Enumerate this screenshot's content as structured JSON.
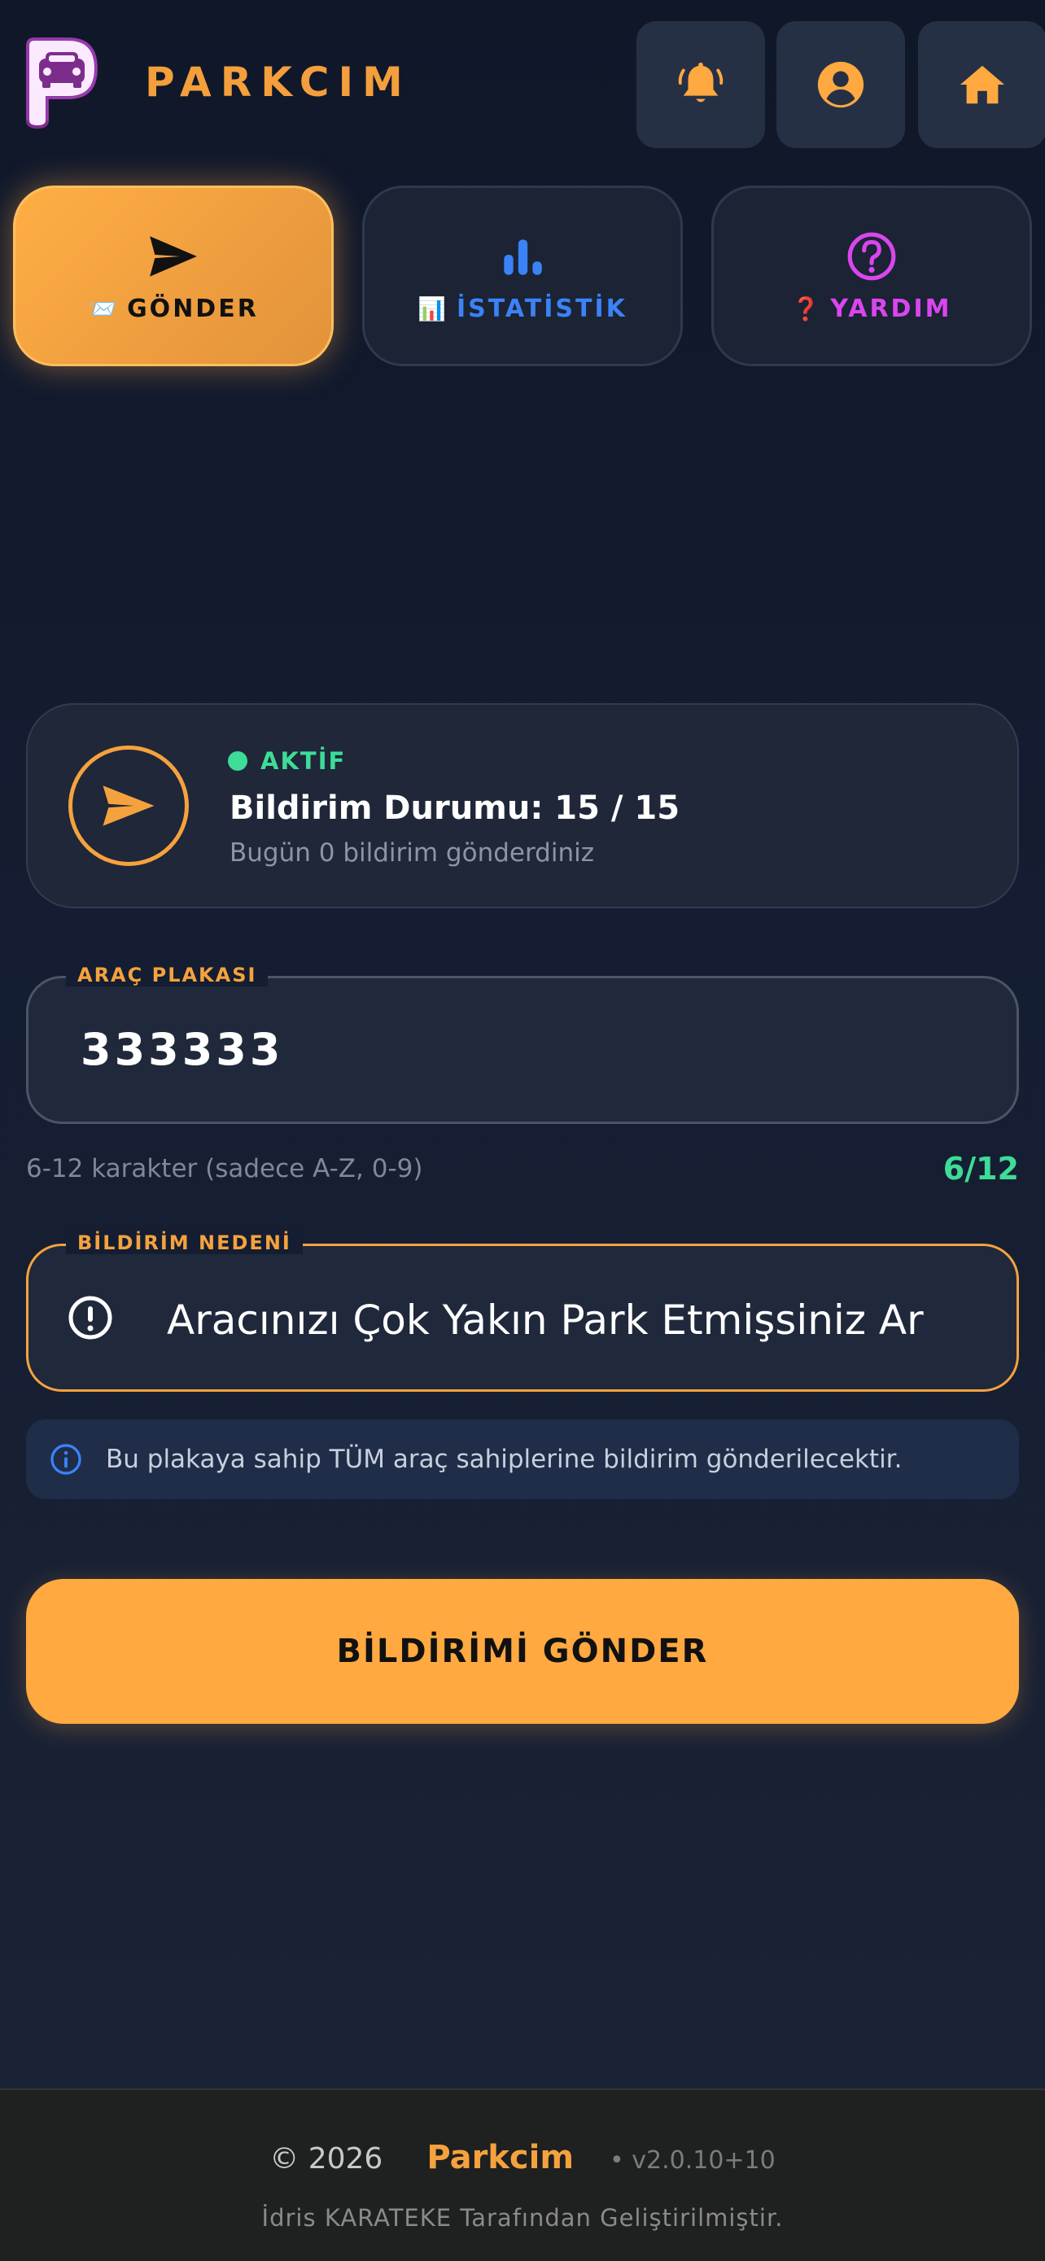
{
  "header": {
    "brand": "PARKCIM",
    "buttons": [
      "notifications",
      "profile",
      "home"
    ]
  },
  "tabs": [
    {
      "emoji": "📨",
      "label": "GÖNDER",
      "icon": "send-icon",
      "color": "#111111",
      "active": true
    },
    {
      "emoji": "📊",
      "label": "İSTATİSTİK",
      "icon": "bar-chart-icon",
      "color": "#3b82f6",
      "active": false
    },
    {
      "emoji": "❓",
      "label": "YARDIM",
      "icon": "help-icon",
      "color": "#d946ef",
      "active": false
    }
  ],
  "status": {
    "state": "AKTİF",
    "title": "Bildirim Durumu: 15 / 15",
    "subtitle": "Bugün 0 bildirim gönderdiniz"
  },
  "plate": {
    "legend": "ARAÇ PLAKASI",
    "value": "333333",
    "hint": "6-12 karakter (sadece A-Z, 0-9)",
    "counter": "6/12"
  },
  "reason": {
    "legend": "BİLDİRİM NEDENİ",
    "value": "Aracınızı Çok Yakın Park Etmişsiniz Ar"
  },
  "info": {
    "text": "Bu plakaya sahip TÜM araç sahiplerine bildirim gönderilecektir."
  },
  "send_button": {
    "label": "BİLDİRİMİ GÖNDER"
  },
  "footer": {
    "copyright": "© 2026",
    "brand": "Parkcim",
    "version": "• v2.0.10+10",
    "credit": "İdris KARATEKE Tarafından Geliştirilmiştir."
  },
  "colors": {
    "accent": "#f5a23e",
    "success": "#3ddc97",
    "background": "#0f1729"
  }
}
